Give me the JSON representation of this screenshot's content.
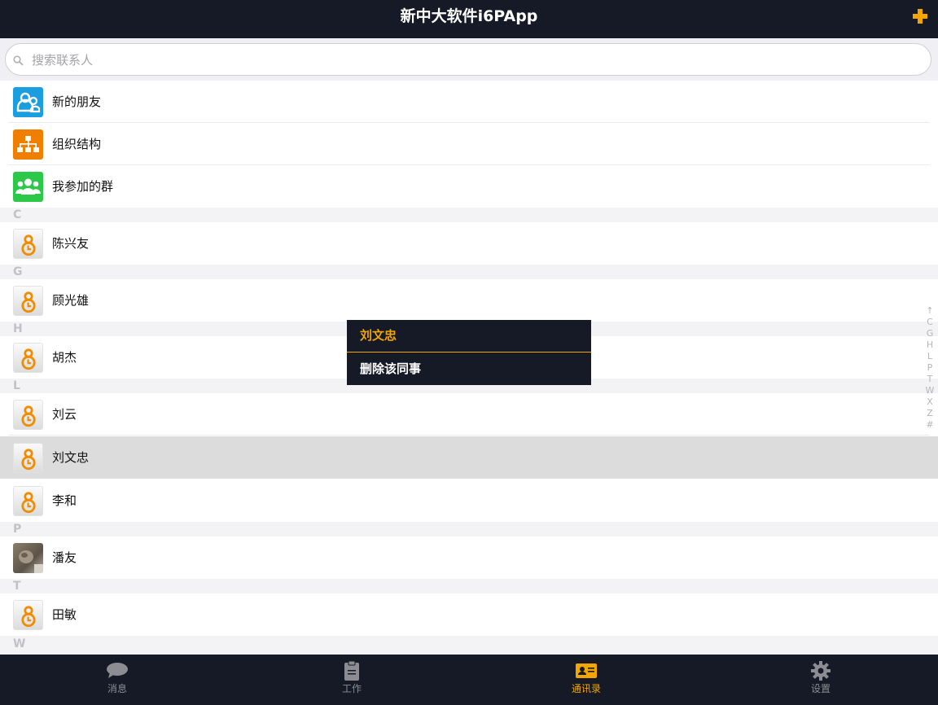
{
  "app": {
    "title": "新中大软件i6PApp"
  },
  "search": {
    "placeholder": "搜索联系人",
    "value": ""
  },
  "fixed_items": [
    {
      "label": "新的朋友",
      "icon": "new-friends-icon",
      "color": "#1a9ee0"
    },
    {
      "label": "组织结构",
      "icon": "org-structure-icon",
      "color": "#f07f00"
    },
    {
      "label": "我参加的群",
      "icon": "groups-icon",
      "color": "#2bc84a"
    }
  ],
  "sections": [
    {
      "letter": "C",
      "contacts": [
        {
          "name": "陈兴友",
          "avatar": "default-avatar-icon"
        }
      ]
    },
    {
      "letter": "G",
      "contacts": [
        {
          "name": "顾光雄",
          "avatar": "default-avatar-icon"
        }
      ]
    },
    {
      "letter": "H",
      "contacts": [
        {
          "name": "胡杰",
          "avatar": "default-avatar-icon"
        }
      ]
    },
    {
      "letter": "L",
      "contacts": [
        {
          "name": "刘云",
          "avatar": "default-avatar-icon"
        },
        {
          "name": "刘文忠",
          "avatar": "default-avatar-icon",
          "selected": true
        },
        {
          "name": "李和",
          "avatar": "default-avatar-icon"
        }
      ]
    },
    {
      "letter": "P",
      "contacts": [
        {
          "name": "潘友",
          "avatar": "photo-avatar"
        }
      ]
    },
    {
      "letter": "T",
      "contacts": [
        {
          "name": "田敏",
          "avatar": "default-avatar-icon"
        }
      ]
    },
    {
      "letter": "W",
      "contacts": []
    }
  ],
  "index_bar": [
    "↑",
    "C",
    "G",
    "H",
    "L",
    "P",
    "T",
    "W",
    "X",
    "Z",
    "#"
  ],
  "popup": {
    "title": "刘文忠",
    "action": "删除该同事"
  },
  "tabs": [
    {
      "label": "消息",
      "icon": "chat-bubble-icon",
      "active": false
    },
    {
      "label": "工作",
      "icon": "clipboard-icon",
      "active": false
    },
    {
      "label": "通讯录",
      "icon": "contact-card-icon",
      "active": true
    },
    {
      "label": "设置",
      "icon": "gear-icon",
      "active": false
    }
  ],
  "colors": {
    "bar": "#151a26",
    "accent": "#f3a600",
    "selected_row": "#dcdcdc"
  }
}
